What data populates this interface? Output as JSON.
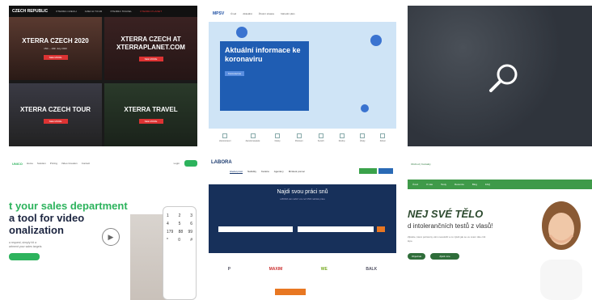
{
  "card1": {
    "logo": "CZECH REPUBLIC",
    "nav": [
      "XTERRA CZECH",
      "CZECH TOUR",
      "XTERRA TRAVEL",
      "XTERRA PLANET"
    ],
    "tiles": [
      {
        "title": "XTERRA CZECH 2020",
        "sub": "15th – 19th July 2020",
        "button": "SEE MORE"
      },
      {
        "title": "XTERRA CZECH AT XTERRAPLANET.COM",
        "sub": "",
        "button": "SEE MORE"
      },
      {
        "title": "XTERRA CZECH TOUR",
        "sub": "",
        "button": "SEE MORE"
      },
      {
        "title": "XTERRA TRAVEL",
        "sub": "",
        "button": "SEE MORE"
      }
    ]
  },
  "card2": {
    "logo": "MPSV",
    "nav": [
      "Úvod",
      "Aktuálně",
      "Životní situace",
      "Národní plán"
    ],
    "title": "Aktuální informace ke koronaviru",
    "chip": "Koronavirus",
    "icons": [
      "Zaměstnanci",
      "Zaměstnavatelé",
      "Dávky",
      "Pěstouni",
      "Senioři",
      "Rodiny",
      "Úřady",
      "Zdraví"
    ]
  },
  "card4": {
    "logo": "UNICO",
    "nav": [
      "Home",
      "Solution",
      "Pricing",
      "Video Creation",
      "Contact"
    ],
    "login": "Login",
    "headline_1": "t your sales department",
    "headline_2": "a tool for video",
    "headline_3": "onalization",
    "para_1": "a request, simply hit a",
    "para_2": "artment your sales targets",
    "keys": [
      [
        "1",
        "2",
        "3"
      ],
      [
        "4",
        "5",
        "6"
      ],
      [
        "7",
        "8",
        "9"
      ],
      [
        "*",
        "0",
        "#"
      ]
    ],
    "key_labels": [
      "179",
      "88",
      "99"
    ]
  },
  "card5": {
    "logo": "LABORA",
    "nav": [
      "Hledat práci",
      "Nabídky",
      "Kariéra",
      "Agentury",
      "Mzdová pomoc"
    ],
    "title": "Najdi svou práci snů",
    "sub": "LABORA vám nabízí více než 2500 nabídek práce",
    "logos": [
      "P",
      "MAXIM",
      "WE",
      "BALK"
    ]
  },
  "card6": {
    "topbar": "Obchod | Kontakty",
    "nav": [
      "Úvod",
      "O nás",
      "Testy",
      "Recenze",
      "Blog",
      "FAQ"
    ],
    "h1": "NEJ SVÉ TĚLO",
    "h2": "d intolerančních testů z vlasů!",
    "p": "Zjistěte, které potraviny vám nesvědčí a co zjistit jak se ve svém těle cítit lépe.",
    "b1": "Objednat",
    "b2": "Zjistit více"
  }
}
